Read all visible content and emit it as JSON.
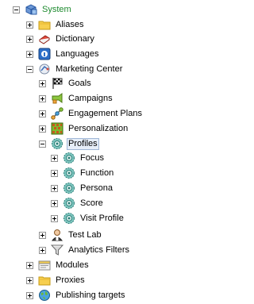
{
  "tree": {
    "root": {
      "label": "System",
      "icon": "system-cube-icon",
      "expanded": true
    },
    "items": [
      {
        "label": "Aliases",
        "icon": "folder-icon"
      },
      {
        "label": "Dictionary",
        "icon": "dictionary-book-icon"
      },
      {
        "label": "Languages",
        "icon": "language-icon"
      },
      {
        "label": "Marketing Center",
        "icon": "marketing-center-icon",
        "expanded": true
      },
      {
        "label": "Goals",
        "icon": "flag-icon"
      },
      {
        "label": "Campaigns",
        "icon": "campaign-icon"
      },
      {
        "label": "Engagement Plans",
        "icon": "engagement-plan-icon"
      },
      {
        "label": "Personalization",
        "icon": "personalization-grid-icon"
      },
      {
        "label": "Profiles",
        "icon": "profile-gear-icon",
        "expanded": true,
        "selected": true
      },
      {
        "label": "Focus",
        "icon": "profile-gear-icon"
      },
      {
        "label": "Function",
        "icon": "profile-gear-icon"
      },
      {
        "label": "Persona",
        "icon": "profile-gear-icon"
      },
      {
        "label": "Score",
        "icon": "profile-gear-icon"
      },
      {
        "label": "Visit Profile",
        "icon": "profile-gear-icon"
      },
      {
        "label": "Test Lab",
        "icon": "test-lab-icon"
      },
      {
        "label": "Analytics Filters",
        "icon": "filter-funnel-icon"
      },
      {
        "label": "Modules",
        "icon": "module-icon"
      },
      {
        "label": "Proxies",
        "icon": "folder-icon"
      },
      {
        "label": "Publishing targets",
        "icon": "globe-icon"
      }
    ]
  },
  "colors": {
    "root_label": "#1d8a2e",
    "selection_border": "#9fb6d6",
    "selection_fill": "#e6eef9",
    "toggle_border": "#919191"
  }
}
